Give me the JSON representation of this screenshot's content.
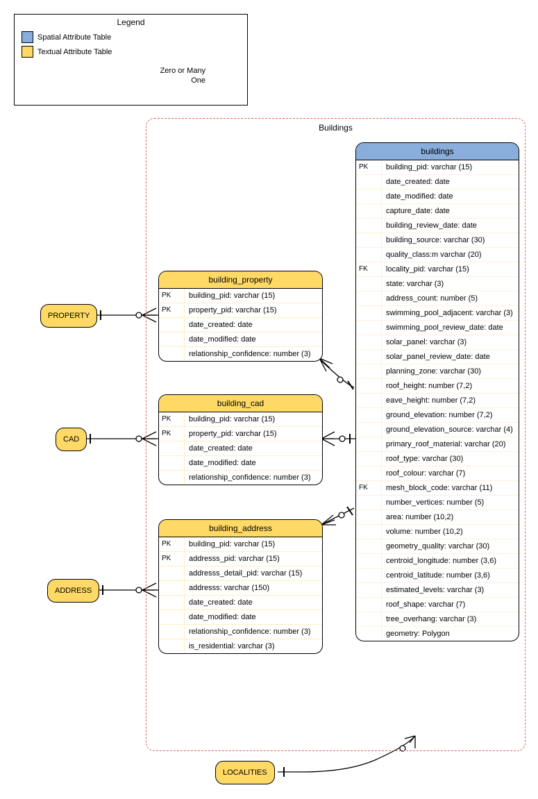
{
  "legend": {
    "title": "Legend",
    "spatial": "Spatial Attribute Table",
    "textual": "Textual Attribute Table",
    "zero_many": "Zero or Many",
    "one": "One"
  },
  "container_label": "Buildings",
  "ext": {
    "property": "PROPERTY",
    "cad": "CAD",
    "address": "ADDRESS",
    "localities": "LOCALITIES"
  },
  "buildings": {
    "name": "buildings",
    "rows": [
      {
        "k": "PK",
        "v": "building_pid: varchar (15)"
      },
      {
        "k": "",
        "v": "date_created: date"
      },
      {
        "k": "",
        "v": "date_modified: date"
      },
      {
        "k": "",
        "v": "capture_date: date"
      },
      {
        "k": "",
        "v": "building_review_date: date"
      },
      {
        "k": "",
        "v": "building_source: varchar (30)"
      },
      {
        "k": "",
        "v": "quality_class:m varchar (20)"
      },
      {
        "k": "FK",
        "v": "locality_pid: varchar (15)"
      },
      {
        "k": "",
        "v": "state: varchar (3)"
      },
      {
        "k": "",
        "v": "address_count: number (5)"
      },
      {
        "k": "",
        "v": "swimming_pool_adjacent: varchar (3)"
      },
      {
        "k": "",
        "v": "swimming_pool_review_date: date"
      },
      {
        "k": "",
        "v": "solar_panel: varchar (3)"
      },
      {
        "k": "",
        "v": "solar_panel_review_date: date"
      },
      {
        "k": "",
        "v": "planning_zone: varchar (30)"
      },
      {
        "k": "",
        "v": "roof_height: number (7,2)"
      },
      {
        "k": "",
        "v": "eave_height: number (7,2)"
      },
      {
        "k": "",
        "v": "ground_elevation: number (7,2)"
      },
      {
        "k": "",
        "v": "ground_elevation_source: varchar (4)"
      },
      {
        "k": "",
        "v": "primary_roof_material: varchar (20)"
      },
      {
        "k": "",
        "v": "roof_type: varchar (30)"
      },
      {
        "k": "",
        "v": "roof_colour: varchar (7)"
      },
      {
        "k": "FK",
        "v": "mesh_block_code: varchar (11)"
      },
      {
        "k": "",
        "v": "number_vertices: number (5)"
      },
      {
        "k": "",
        "v": "area: number (10,2)"
      },
      {
        "k": "",
        "v": "volume: number (10,2)"
      },
      {
        "k": "",
        "v": "geometry_quality: varchar (30)"
      },
      {
        "k": "",
        "v": "centroid_longitude: number (3,6)"
      },
      {
        "k": "",
        "v": "centroid_latitude: number (3,6)"
      },
      {
        "k": "",
        "v": "estimated_levels: varchar (3)"
      },
      {
        "k": "",
        "v": "roof_shape: varchar (7)"
      },
      {
        "k": "",
        "v": "tree_overhang: varchar (3)"
      },
      {
        "k": "",
        "v": "geometry: Polygon"
      }
    ]
  },
  "building_property": {
    "name": "building_property",
    "rows": [
      {
        "k": "PK",
        "v": "building_pid: varchar (15)"
      },
      {
        "k": "PK",
        "v": "property_pid: varchar (15)"
      },
      {
        "k": "",
        "v": "date_created: date"
      },
      {
        "k": "",
        "v": "date_modified: date"
      },
      {
        "k": "",
        "v": "relationship_confidence: number (3)"
      }
    ]
  },
  "building_cad": {
    "name": "building_cad",
    "rows": [
      {
        "k": "PK",
        "v": "building_pid: varchar (15)"
      },
      {
        "k": "PK",
        "v": "property_pid: varchar (15)"
      },
      {
        "k": "",
        "v": "date_created: date"
      },
      {
        "k": "",
        "v": "date_modified: date"
      },
      {
        "k": "",
        "v": "relationship_confidence: number (3)"
      }
    ]
  },
  "building_address": {
    "name": "building_address",
    "rows": [
      {
        "k": "PK",
        "v": "building_pid: varchar (15)"
      },
      {
        "k": "PK",
        "v": "addresss_pid: varchar (15)"
      },
      {
        "k": "",
        "v": "addresss_detail_pid: varchar (15)"
      },
      {
        "k": "",
        "v": "addresss: varchar (150)"
      },
      {
        "k": "",
        "v": "date_created: date"
      },
      {
        "k": "",
        "v": "date_modified: date"
      },
      {
        "k": "",
        "v": "relationship_confidence: number (3)"
      },
      {
        "k": "",
        "v": "is_residential: varchar (3)"
      }
    ]
  }
}
